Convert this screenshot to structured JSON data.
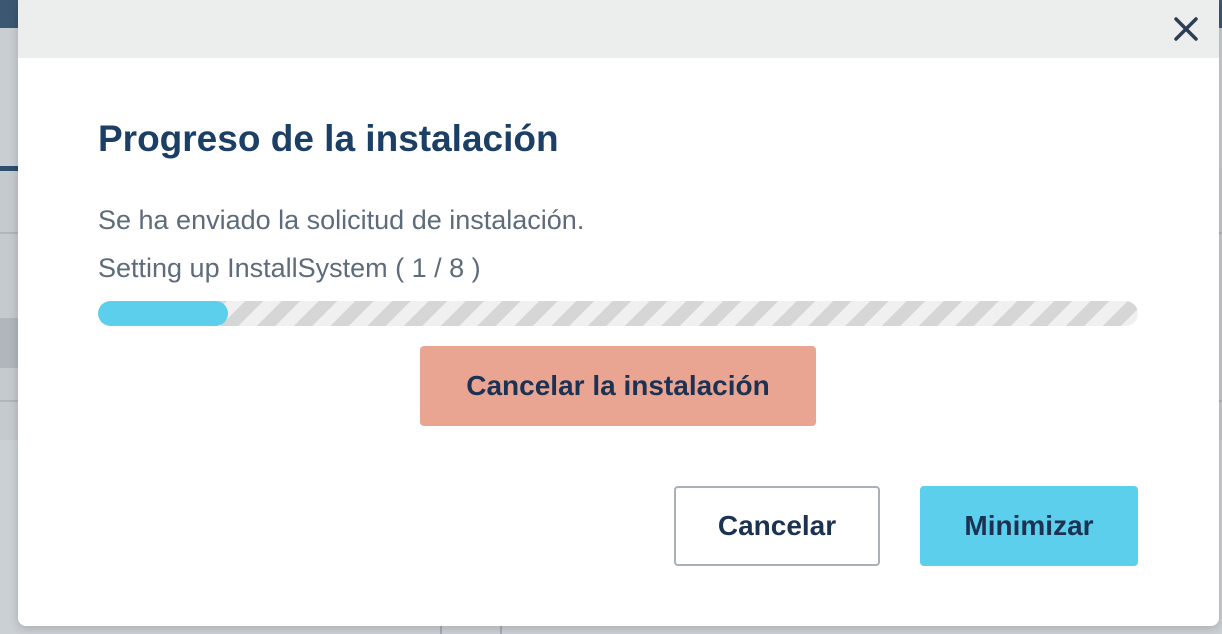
{
  "modal": {
    "title": "Progreso de la instalación",
    "message": "Se ha enviado la solicitud de instalación.",
    "step_text": "Setting up InstallSystem ( 1 / 8 )",
    "progress": {
      "current_step": 1,
      "total_steps": 8,
      "fill_fraction": 0.125
    },
    "cancel_install_label": "Cancelar la instalación",
    "cancel_label": "Cancelar",
    "minimize_label": "Minimizar",
    "close_icon": "close-icon"
  },
  "colors": {
    "title": "#1c3f66",
    "progress_fill": "#5ccfec",
    "cancel_install_bg": "#e9a492",
    "minimize_bg": "#5ccfec",
    "header_bg": "#eceeed"
  }
}
